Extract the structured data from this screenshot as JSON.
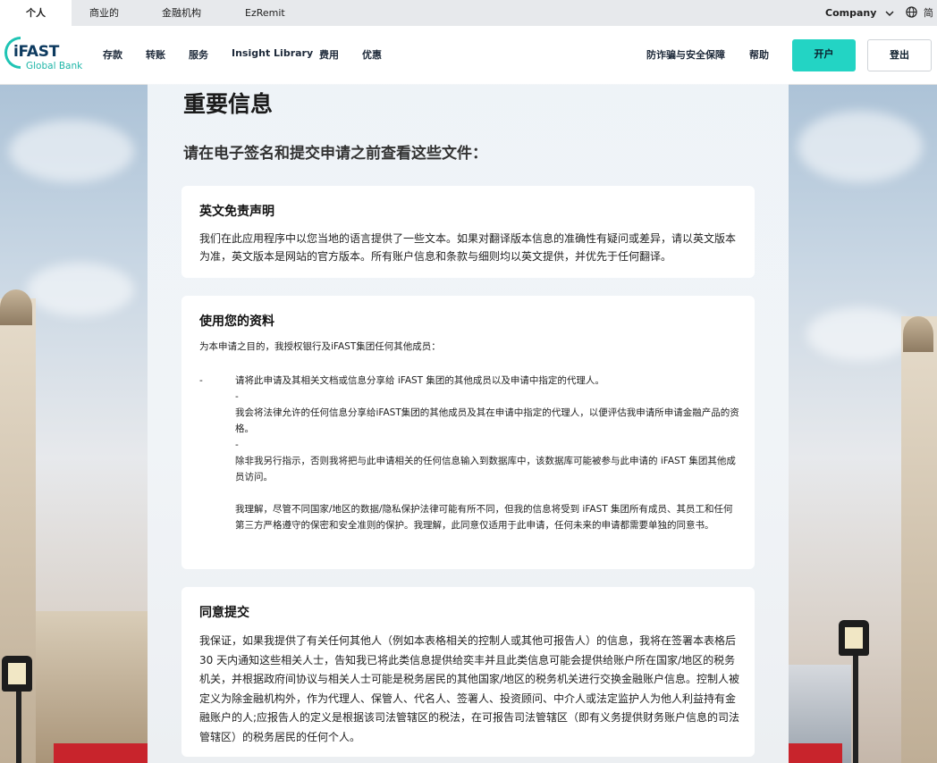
{
  "topbar": {
    "tabs": [
      "个人",
      "商业的",
      "金融机构",
      "EzRemit"
    ],
    "company": "Company",
    "language": "简"
  },
  "brand": {
    "name": "iFAST",
    "sub": "Global Bank"
  },
  "nav": {
    "items": [
      "存款",
      "转账",
      "服务",
      "Insight Library",
      "费用",
      "优惠"
    ],
    "right_items": [
      "防诈骗与安全保障",
      "帮助"
    ],
    "open_button": "开户",
    "logout_button": "登出"
  },
  "page": {
    "title": "重要信息",
    "subtitle": "请在电子签名和提交申请之前查看这些文件："
  },
  "cards": {
    "disclaimer": {
      "title": "英文免责声明",
      "body": "我们在此应用程序中以您当地的语言提供了一些文本。如果对翻译版本信息的准确性有疑问或差异，请以英文版本为准，英文版本是网站的官方版本。所有账户信息和条款与细则均以英文提供，并优先于任何翻译。"
    },
    "data_use": {
      "title": "使用您的资料",
      "intro": "为本申请之目的，我授权银行及iFAST集团任何其他成员：",
      "bullet": "-",
      "items": [
        "请将此申请及其相关文档或信息分享给 iFAST 集团的其他成员以及申请中指定的代理人。",
        "-",
        "我会将法律允许的任何信息分享给iFAST集团的其他成员及其在申请中指定的代理人，以便评估我申请所申请金融产品的资格。",
        "-",
        "除非我另行指示，否则我将把与此申请相关的任何信息输入到数据库中，该数据库可能被参与此申请的 iFAST 集团其他成员访问。",
        "我理解，尽管不同国家/地区的数据/隐私保护法律可能有所不同，但我的信息将受到 iFAST 集团所有成员、其员工和任何第三方严格遵守的保密和安全准则的保护。我理解，此同意仅适用于此申请，任何未来的申请都需要单独的同意书。"
      ]
    },
    "consent": {
      "title": "同意提交",
      "body": "我保证，如果我提供了有关任何其他人（例如本表格相关的控制人或其他可报告人）的信息，我将在签署本表格后 30 天内通知这些相关人士，告知我已将此类信息提供给奕丰并且此类信息可能会提供给账户所在国家/地区的税务机关，并根据政府间协议与相关人士可能是税务居民的其他国家/地区的税务机关进行交换金融账户信息。控制人被定义为除金融机构外，作为代理人、保管人、代名人、签署人、投资顾问、中介人或法定监护人为他人利益持有金融账户的人;应报告人的定义是根据该司法管辖区的税法，在可报告司法管辖区（即有义务提供财务账户信息的司法管辖区）的税务居民的任何个人。"
    }
  }
}
